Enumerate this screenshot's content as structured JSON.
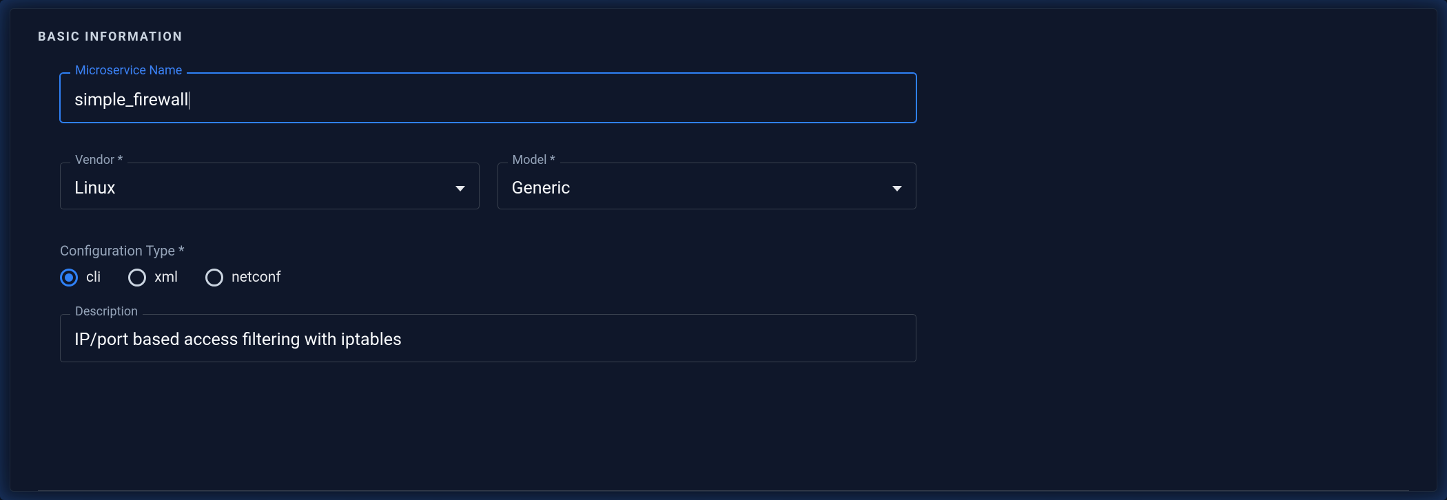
{
  "section": {
    "title": "BASIC INFORMATION"
  },
  "fields": {
    "name": {
      "label": "Microservice Name",
      "value": "simple_firewall"
    },
    "vendor": {
      "label": "Vendor *",
      "value": "Linux"
    },
    "model": {
      "label": "Model *",
      "value": "Generic"
    },
    "description": {
      "label": "Description",
      "value": "IP/port based access filtering with iptables"
    }
  },
  "configType": {
    "label": "Configuration Type *",
    "options": [
      "cli",
      "xml",
      "netconf"
    ],
    "selected": "cli"
  }
}
